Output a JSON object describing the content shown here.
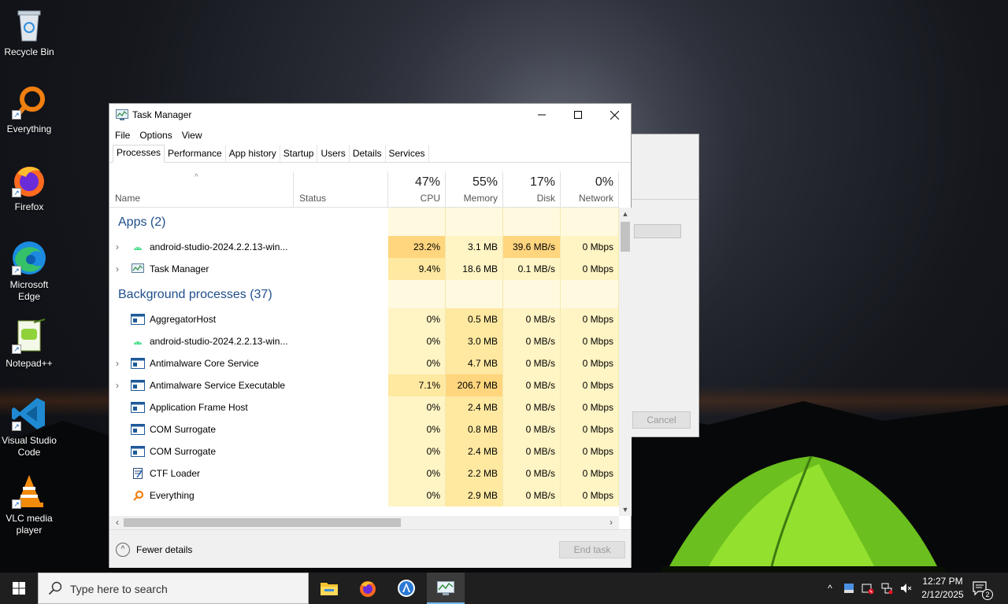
{
  "desktop": {
    "icons": [
      {
        "label": "Recycle Bin"
      },
      {
        "label": "Everything"
      },
      {
        "label": "Firefox"
      },
      {
        "label": "Microsoft Edge"
      },
      {
        "label": "Notepad++"
      },
      {
        "label": "Visual Studio Code"
      },
      {
        "label": "VLC media player"
      }
    ]
  },
  "bg_dialog": {
    "cancel_label": "Cancel"
  },
  "taskmanager": {
    "title": "Task Manager",
    "menu": {
      "file": "File",
      "options": "Options",
      "view": "View"
    },
    "tabs": [
      "Processes",
      "Performance",
      "App history",
      "Startup",
      "Users",
      "Details",
      "Services"
    ],
    "columns": {
      "name": "Name",
      "status": "Status",
      "cpu": {
        "label": "CPU",
        "pct": "47%"
      },
      "memory": {
        "label": "Memory",
        "pct": "55%"
      },
      "disk": {
        "label": "Disk",
        "pct": "17%"
      },
      "network": {
        "label": "Network",
        "pct": "0%"
      }
    },
    "groups": {
      "apps": "Apps (2)",
      "background": "Background processes (37)"
    },
    "apps": [
      {
        "name": "android-studio-2024.2.2.13-win...",
        "cpu": "23.2%",
        "memory": "3.1 MB",
        "disk": "39.6 MB/s",
        "network": "0 Mbps"
      },
      {
        "name": "Task Manager",
        "cpu": "9.4%",
        "memory": "18.6 MB",
        "disk": "0.1 MB/s",
        "network": "0 Mbps"
      }
    ],
    "background": [
      {
        "name": "AggregatorHost",
        "cpu": "0%",
        "memory": "0.5 MB",
        "disk": "0 MB/s",
        "network": "0 Mbps"
      },
      {
        "name": "android-studio-2024.2.2.13-win...",
        "cpu": "0%",
        "memory": "3.0 MB",
        "disk": "0 MB/s",
        "network": "0 Mbps"
      },
      {
        "name": "Antimalware Core Service",
        "cpu": "0%",
        "memory": "4.7 MB",
        "disk": "0 MB/s",
        "network": "0 Mbps"
      },
      {
        "name": "Antimalware Service Executable",
        "cpu": "7.1%",
        "memory": "206.7 MB",
        "disk": "0 MB/s",
        "network": "0 Mbps"
      },
      {
        "name": "Application Frame Host",
        "cpu": "0%",
        "memory": "2.4 MB",
        "disk": "0 MB/s",
        "network": "0 Mbps"
      },
      {
        "name": "COM Surrogate",
        "cpu": "0%",
        "memory": "0.8 MB",
        "disk": "0 MB/s",
        "network": "0 Mbps"
      },
      {
        "name": "COM Surrogate",
        "cpu": "0%",
        "memory": "2.4 MB",
        "disk": "0 MB/s",
        "network": "0 Mbps"
      },
      {
        "name": "CTF Loader",
        "cpu": "0%",
        "memory": "2.2 MB",
        "disk": "0 MB/s",
        "network": "0 Mbps"
      },
      {
        "name": "Everything",
        "cpu": "0%",
        "memory": "2.9 MB",
        "disk": "0 MB/s",
        "network": "0 Mbps"
      }
    ],
    "footer": {
      "fewer_details": "Fewer details",
      "end_task": "End task"
    }
  },
  "taskbar": {
    "search_placeholder": "Type here to search",
    "time": "12:27 PM",
    "date": "2/12/2025",
    "notification_count": "2"
  }
}
